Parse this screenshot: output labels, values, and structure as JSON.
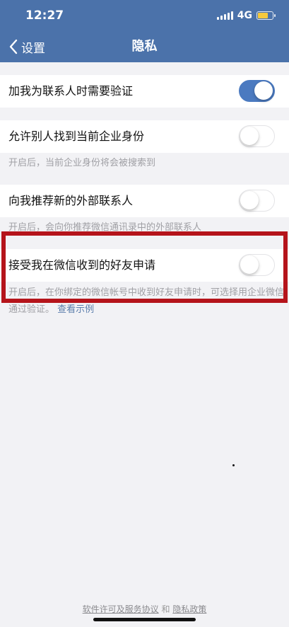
{
  "status_bar": {
    "time": "12:27",
    "network": "4G",
    "icons": [
      "signal-icon",
      "battery-icon"
    ],
    "battery_color": "#f5c93d"
  },
  "nav": {
    "back_label": "设置",
    "title": "隐私",
    "color": "#4b72aa"
  },
  "settings": {
    "verify_contact": {
      "label": "加我为联系人时需要验证",
      "enabled": true
    },
    "find_by_identity": {
      "label": "允许别人找到当前企业身份",
      "enabled": false,
      "hint": "开启后，当前企业身份将会被搜索到"
    },
    "recommend_external": {
      "label": "向我推荐新的外部联系人",
      "enabled": false,
      "hint": "开启后，会向你推荐微信通讯录中的外部联系人"
    },
    "accept_wechat_requests": {
      "label": "接受我在微信收到的好友申请",
      "enabled": false,
      "hint": "开启后，在你绑定的微信帐号中收到好友申请时，可选择用企业微信通过验证。",
      "hint_link": "查看示例"
    }
  },
  "footer": {
    "terms_link": "软件许可及服务协议",
    "conjunction": " 和 ",
    "privacy_link": "隐私政策"
  },
  "highlight_color": "#b5141b"
}
